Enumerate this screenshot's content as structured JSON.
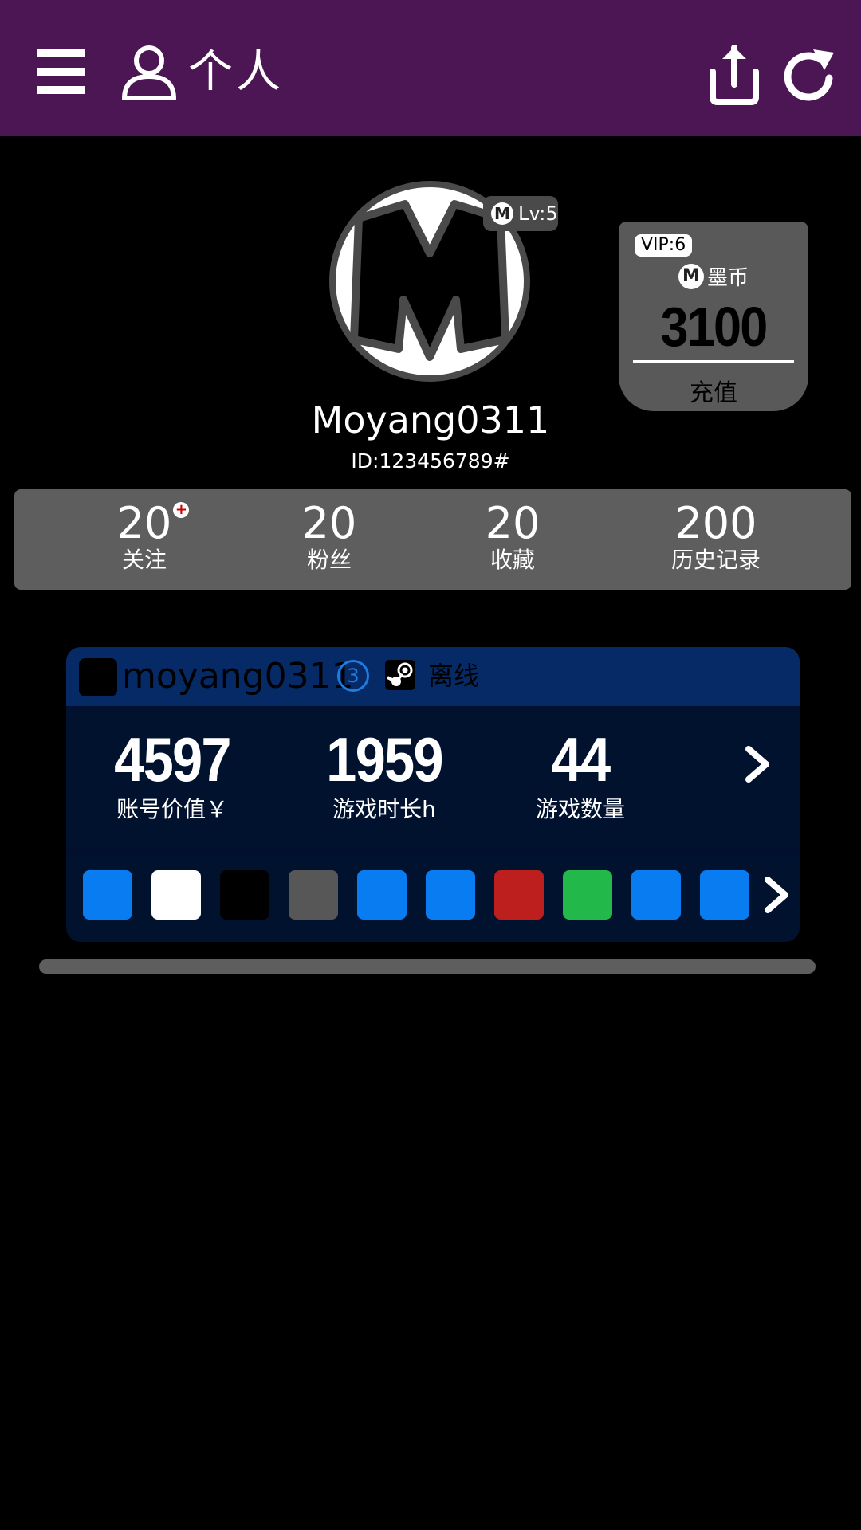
{
  "header": {
    "title": "个人",
    "icons": {
      "menu": "menu-icon",
      "user": "user-icon",
      "share": "share-icon",
      "refresh": "refresh-icon"
    }
  },
  "profile": {
    "avatar_letter": "M",
    "level": "Lv:5",
    "level_icon_letter": "M",
    "username": "Moyang0311",
    "id": "ID:123456789#"
  },
  "vip": {
    "tag": "VIP:6",
    "coin_icon_letter": "M",
    "coin_label": "墨币",
    "coin_value": "3100",
    "recharge": "充值"
  },
  "stats": [
    {
      "value": "20",
      "label": "关注",
      "badge": "+"
    },
    {
      "value": "20",
      "label": "粉丝"
    },
    {
      "value": "20",
      "label": "收藏"
    },
    {
      "value": "200",
      "label": "历史记录"
    }
  ],
  "game": {
    "username": "moyang0311",
    "friend_count": "3",
    "platform_icon": "steam-icon",
    "status": "离线",
    "stats": [
      {
        "value": "4597",
        "label": "账号价值￥"
      },
      {
        "value": "1959",
        "label": "游戏时长h"
      },
      {
        "value": "44",
        "label": "游戏数量"
      }
    ],
    "tiles": [
      "#0a7cf2",
      "#ffffff",
      "#000000",
      "#575757",
      "#0a7cf2",
      "#0a7cf2",
      "#bd1f1f",
      "#22b84a",
      "#0a7cf2",
      "#0a7cf2"
    ]
  },
  "colors": {
    "topbar": "#4b1653",
    "stats_bg": "#5e5e5e",
    "game_header": "#062a66",
    "game_body": "#01122e"
  }
}
